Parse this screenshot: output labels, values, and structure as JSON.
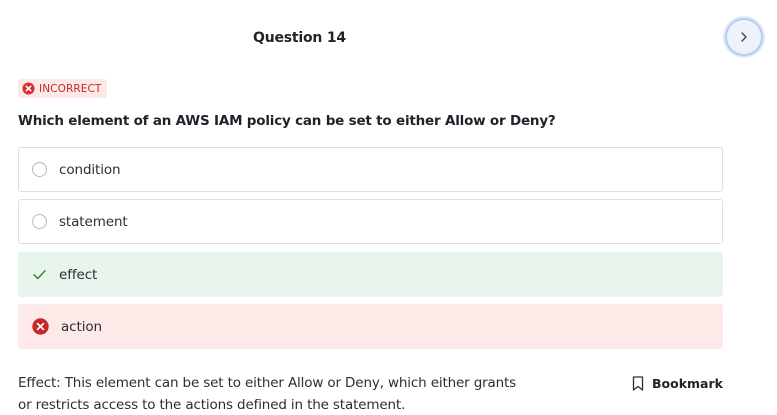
{
  "header": {
    "question_title": "Question 14"
  },
  "status": {
    "label": "INCORRECT",
    "icon": "x-circle-icon",
    "color": "#c62828"
  },
  "question": {
    "text": "Which element of an AWS IAM policy can be set to either Allow or Deny?"
  },
  "options": [
    {
      "label": "condition",
      "state": "unselected"
    },
    {
      "label": "statement",
      "state": "unselected"
    },
    {
      "label": "effect",
      "state": "correct"
    },
    {
      "label": "action",
      "state": "incorrect"
    }
  ],
  "explanation": {
    "text": "Effect: This element can be set to either Allow or Deny, which either grants or restricts access to the actions defined in the statement."
  },
  "bookmark": {
    "label": "Bookmark",
    "icon": "bookmark-icon"
  },
  "navigation": {
    "next_icon": "chevron-right-icon"
  },
  "colors": {
    "correct_bg": "#e8f5ec",
    "correct_icon": "#2e7d32",
    "incorrect_bg": "#fde9e8",
    "incorrect_icon": "#c62828",
    "accent": "#b7cbee"
  }
}
